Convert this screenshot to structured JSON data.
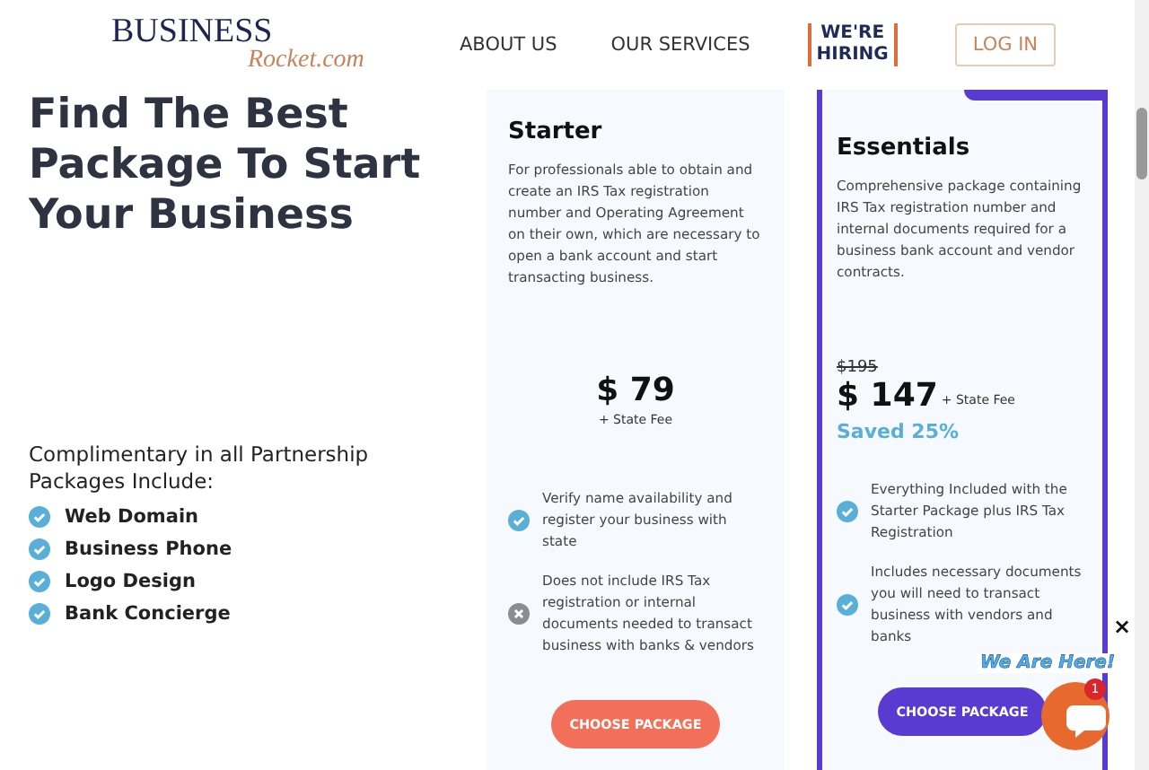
{
  "header": {
    "logo_top": "BUSINESS",
    "logo_bottom": "Rocket.com",
    "nav": [
      "ABOUT US",
      "OUR SERVICES"
    ],
    "hiring_top": "WE'RE",
    "hiring_bottom": "HIRING",
    "login": "LOG IN"
  },
  "hero": {
    "heading": [
      "Find The Best",
      "Package To Start",
      "Your Business"
    ],
    "complimentary": "Complimentary in all Partnership Packages Include:",
    "perks": [
      "Web Domain",
      "Business Phone",
      "Logo Design",
      "Bank Concierge"
    ]
  },
  "packages": [
    {
      "name": "Starter",
      "highlighted": false,
      "description": "For professionals able to obtain and create an IRS Tax registration number and Operating Agreement on their own, which are necessary to open a bank account and start transacting business.",
      "price": "$ 79",
      "fee": "+ State Fee",
      "features": [
        {
          "text": "Verify name availability and register your business with state",
          "included": true
        },
        {
          "text": "Does not include IRS Tax registration or internal documents needed to transact business with banks & vendors",
          "included": false
        }
      ],
      "button": "CHOOSE PACKAGE"
    },
    {
      "name": "Essentials",
      "highlighted": true,
      "description": "Comprehensive package containing IRS Tax registration number and internal documents required for a business bank account and vendor contracts.",
      "old_price": "$195",
      "price": "$ 147",
      "fee": "+ State Fee",
      "saved": "Saved 25%",
      "features": [
        {
          "text": "Everything Included with the Starter Package plus IRS Tax Registration",
          "included": true
        },
        {
          "text": "Includes necessary documents you will need to transact business with vendors and banks",
          "included": true
        }
      ],
      "button": "CHOOSE PACKAGE"
    }
  ],
  "chat": {
    "tagline": "We Are Here!",
    "badge": "1",
    "close": "×"
  }
}
